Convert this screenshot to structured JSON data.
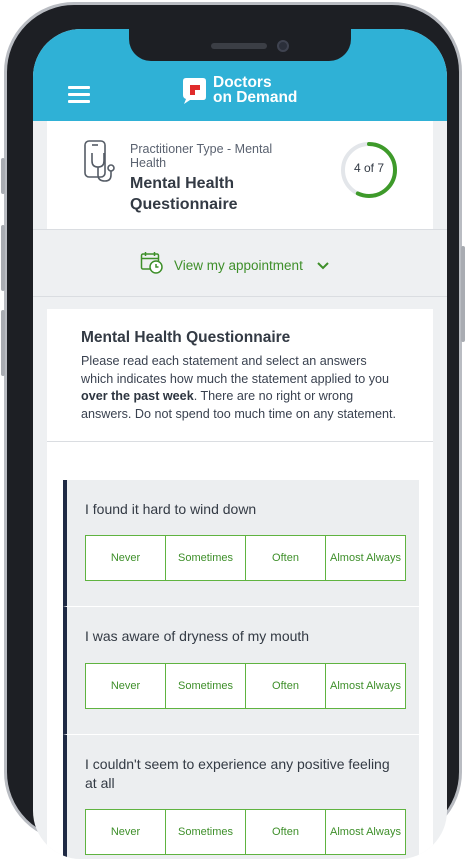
{
  "app": {
    "brand_line1": "Doctors",
    "brand_line2": "on Demand",
    "brand_color": "#2fb1d6",
    "accent_color": "#3e8f2a"
  },
  "header": {
    "practitioner_type": "Practitioner Type - Mental Health",
    "title": "Mental Health Questionnaire",
    "progress_text": "4 of 7",
    "progress_fraction": 0.57
  },
  "appointment": {
    "label": "View my appointment",
    "icon": "calendar-clock-icon"
  },
  "questionnaire": {
    "title": "Mental Health Questionnaire",
    "instructions_part1": "Please read each statement and select an answers which indicates how much the statement applied to you ",
    "instructions_bold": "over the past week",
    "instructions_part2": ". There are no right or wrong answers. Do not spend too much time on any statement.",
    "options": [
      "Never",
      "Sometimes",
      "Often",
      "Almost Always"
    ],
    "questions": [
      {
        "text": "I found it hard to wind down"
      },
      {
        "text": "I was aware of dryness of my mouth"
      },
      {
        "text": "I couldn't seem to experience any positive feeling at all"
      }
    ]
  }
}
